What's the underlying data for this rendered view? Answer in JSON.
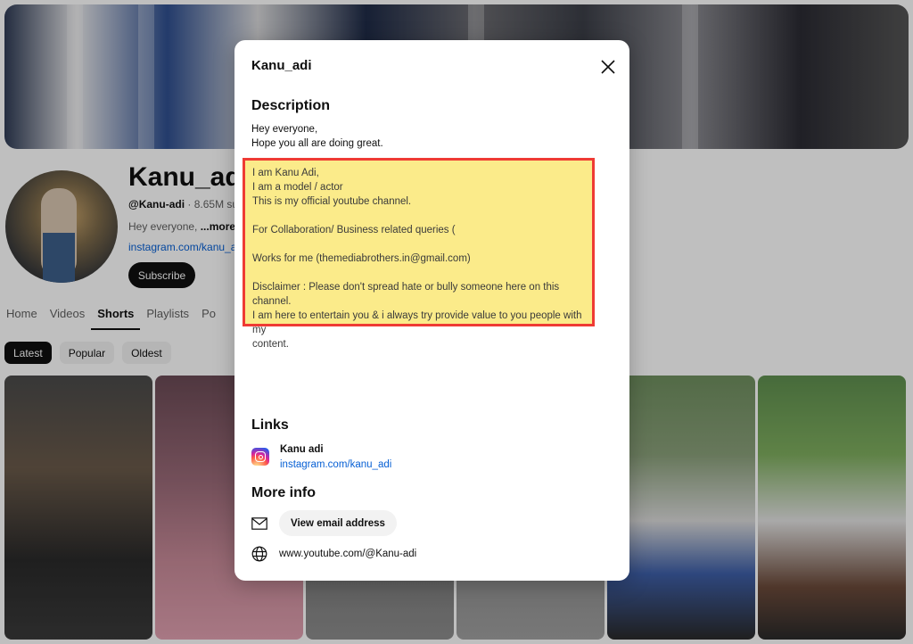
{
  "channel": {
    "name": "Kanu_adi",
    "handle": "@Kanu-adi",
    "subs_partial": " · 8.65M subs",
    "desc_partial": "Hey everyone, ",
    "more_label": "...more",
    "link_partial": "instagram.com/kanu_ad",
    "subscribe_label": "Subscribe"
  },
  "tabs": [
    "Home",
    "Videos",
    "Shorts",
    "Playlists",
    "Po"
  ],
  "active_tab": "Shorts",
  "chips": [
    "Latest",
    "Popular",
    "Oldest"
  ],
  "modal": {
    "title": "Kanu_adi",
    "description_heading": "Description",
    "desc_intro": [
      "Hey everyone,",
      "Hope you all are doing great."
    ],
    "desc_highlight": [
      "I am Kanu Adi,",
      "I am a model / actor",
      "This is my official youtube channel.",
      "",
      "For Collaboration/ Business related queries (",
      "",
      "Works for me (themediabrothers.in@gmail.com)",
      "",
      "Disclaimer : Please don't spread hate or bully someone here on this channel.",
      "I am here to entertain you & i always try provide value to you people with my",
      "content."
    ],
    "links_heading": "Links",
    "link_name": "Kanu adi",
    "link_url": "instagram.com/kanu_adi",
    "more_info_heading": "More info",
    "email_button": "View email address",
    "channel_url": "www.youtube.com/@Kanu-adi"
  },
  "colors": {
    "highlight_fill": "#fbeb8a",
    "highlight_border": "#ef3b34",
    "link_blue": "#065fd4"
  },
  "icons": [
    "close-icon",
    "instagram-icon",
    "mail-icon",
    "globe-icon"
  ]
}
